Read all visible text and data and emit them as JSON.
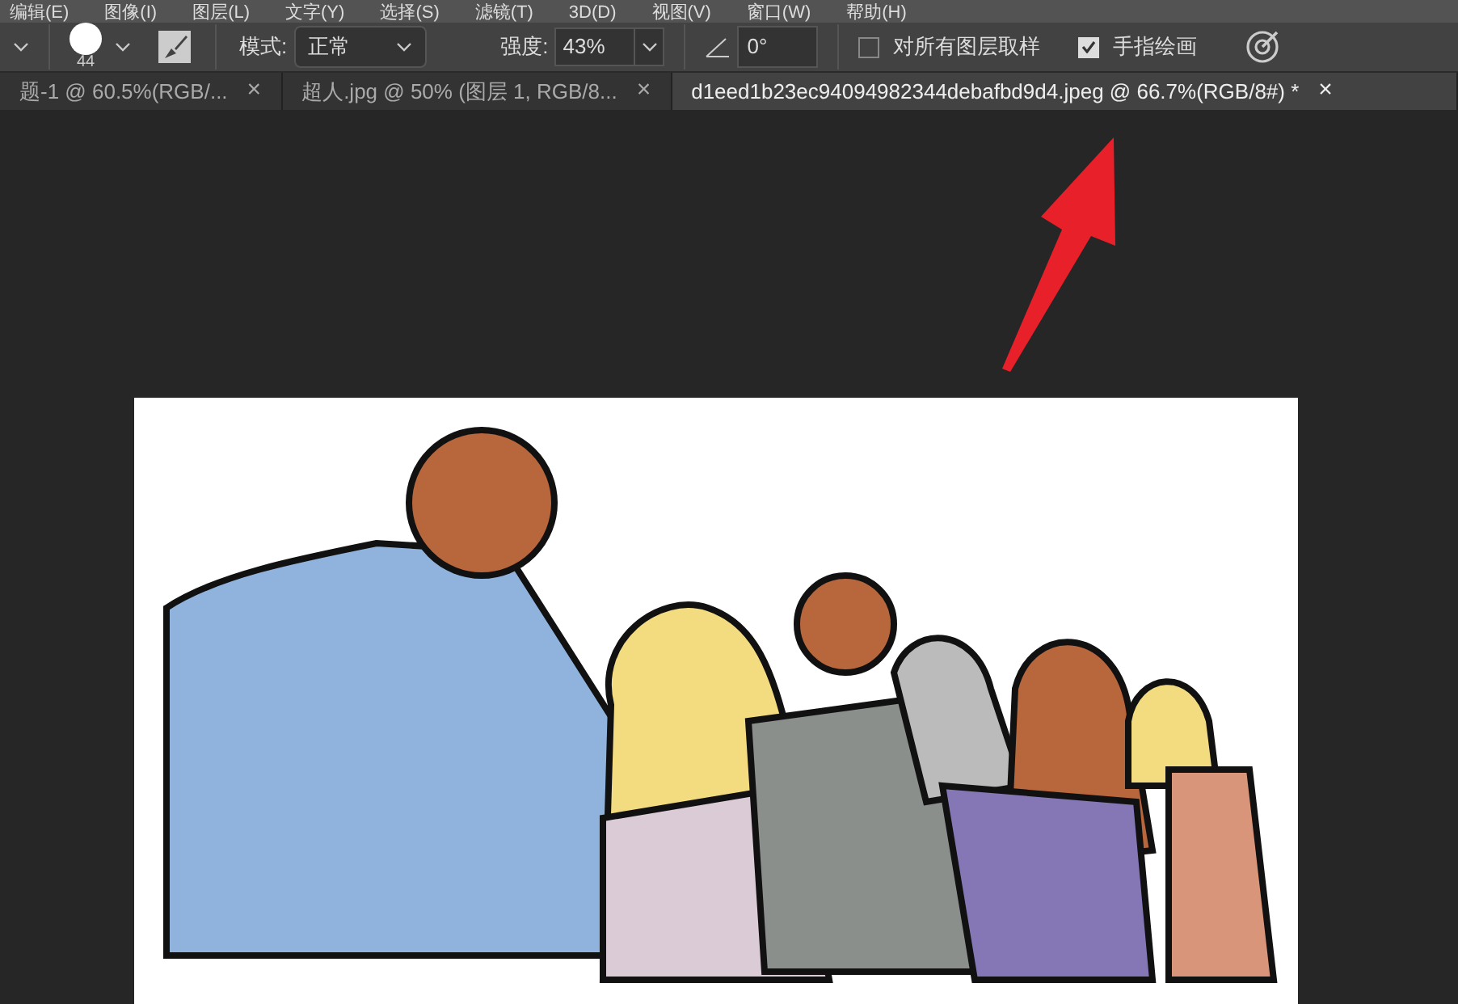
{
  "menu": [
    "编辑(E)",
    "图像(I)",
    "图层(L)",
    "文字(Y)",
    "选择(S)",
    "滤镜(T)",
    "3D(D)",
    "视图(V)",
    "窗口(W)",
    "帮助(H)"
  ],
  "toolbar": {
    "brush_size": "44",
    "mode_label": "模式:",
    "mode_value": "正常",
    "strength_label": "强度:",
    "strength_value": "43%",
    "angle_value": "0°",
    "options": [
      {
        "label": "对所有图层取样",
        "checked": false
      },
      {
        "label": "手指绘画",
        "checked": true
      }
    ]
  },
  "tabs": [
    {
      "title": "题-1 @ 60.5%(RGB/...",
      "close": "×",
      "selected": false
    },
    {
      "title": "超人.jpg @ 50% (图层 1, RGB/8...",
      "close": "×",
      "selected": false
    },
    {
      "title": "d1eed1b23ec94094982344debafbd9d4.jpeg @ 66.7%(RGB/8#) *",
      "close": "×",
      "selected": true
    }
  ]
}
